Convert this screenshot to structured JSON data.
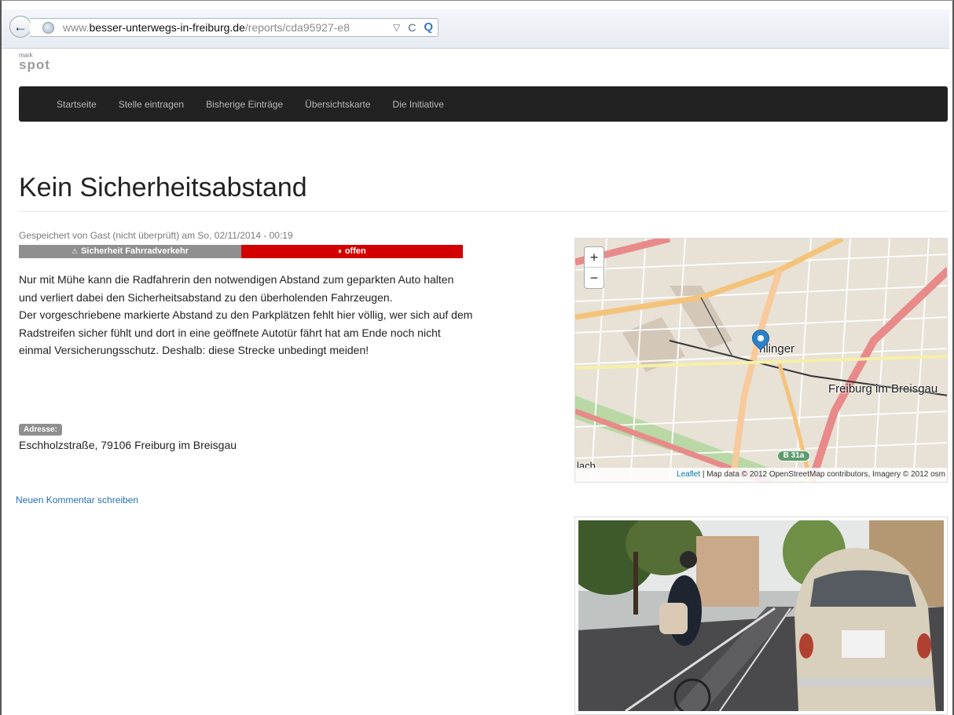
{
  "browser": {
    "url_prefix": "www.",
    "url_host": "besser-unterwegs-in-freiburg.de",
    "url_path": "/reports/cda95927-e8",
    "back_icon": "back-arrow-icon",
    "url_dropdown_glyph": "▽",
    "reload_glyph": "C",
    "search_glyph": "Q"
  },
  "logo": {
    "top": "mark",
    "bottom": "spot"
  },
  "nav": {
    "items": [
      {
        "label": "Startseite"
      },
      {
        "label": "Stelle eintragen"
      },
      {
        "label": "Bisherige Einträge"
      },
      {
        "label": "Übersichtskarte"
      },
      {
        "label": "Die Initiative"
      }
    ]
  },
  "report": {
    "title": "Kein Sicherheitsabstand",
    "meta": "Gespeichert von Gast (nicht überprüft) am So, 02/11/2014 - 00:19",
    "category": "Sicherheit Fahrradverkehr",
    "status": "offen",
    "status_color": "#d40000",
    "category_color": "#8f8f8f",
    "description_1": "Nur mit Mühe kann die Radfahrerin den notwendigen Abstand zum geparkten Auto halten und verliert dabei den Sicherheitsabstand zu den überholenden Fahrzeugen.",
    "description_2": "Der vorgeschriebene markierte Abstand zu den Parkplätzen fehlt hier völlig, wer sich auf dem Radstreifen sicher fühlt und dort in eine geöffnete Autotür fährt hat am Ende noch nicht einmal Versicherungsschutz. Deshalb: diese Strecke unbedingt meiden!",
    "address_label": "Adresse:",
    "address": "Eschholzstraße, 79106 Freiburg im Breisgau",
    "comment_link": "Neuen Kommentar schreiben"
  },
  "map": {
    "zoom_in": "+",
    "zoom_out": "−",
    "place_1": "hlinger",
    "place_2": "Freiburg im Breisgau",
    "place_3": "lach",
    "road": "B 31a",
    "attribution_link": "Leaflet",
    "attribution_text": " | Map data © 2012 OpenStreetMap contributors, Imagery © 2012 osm"
  }
}
